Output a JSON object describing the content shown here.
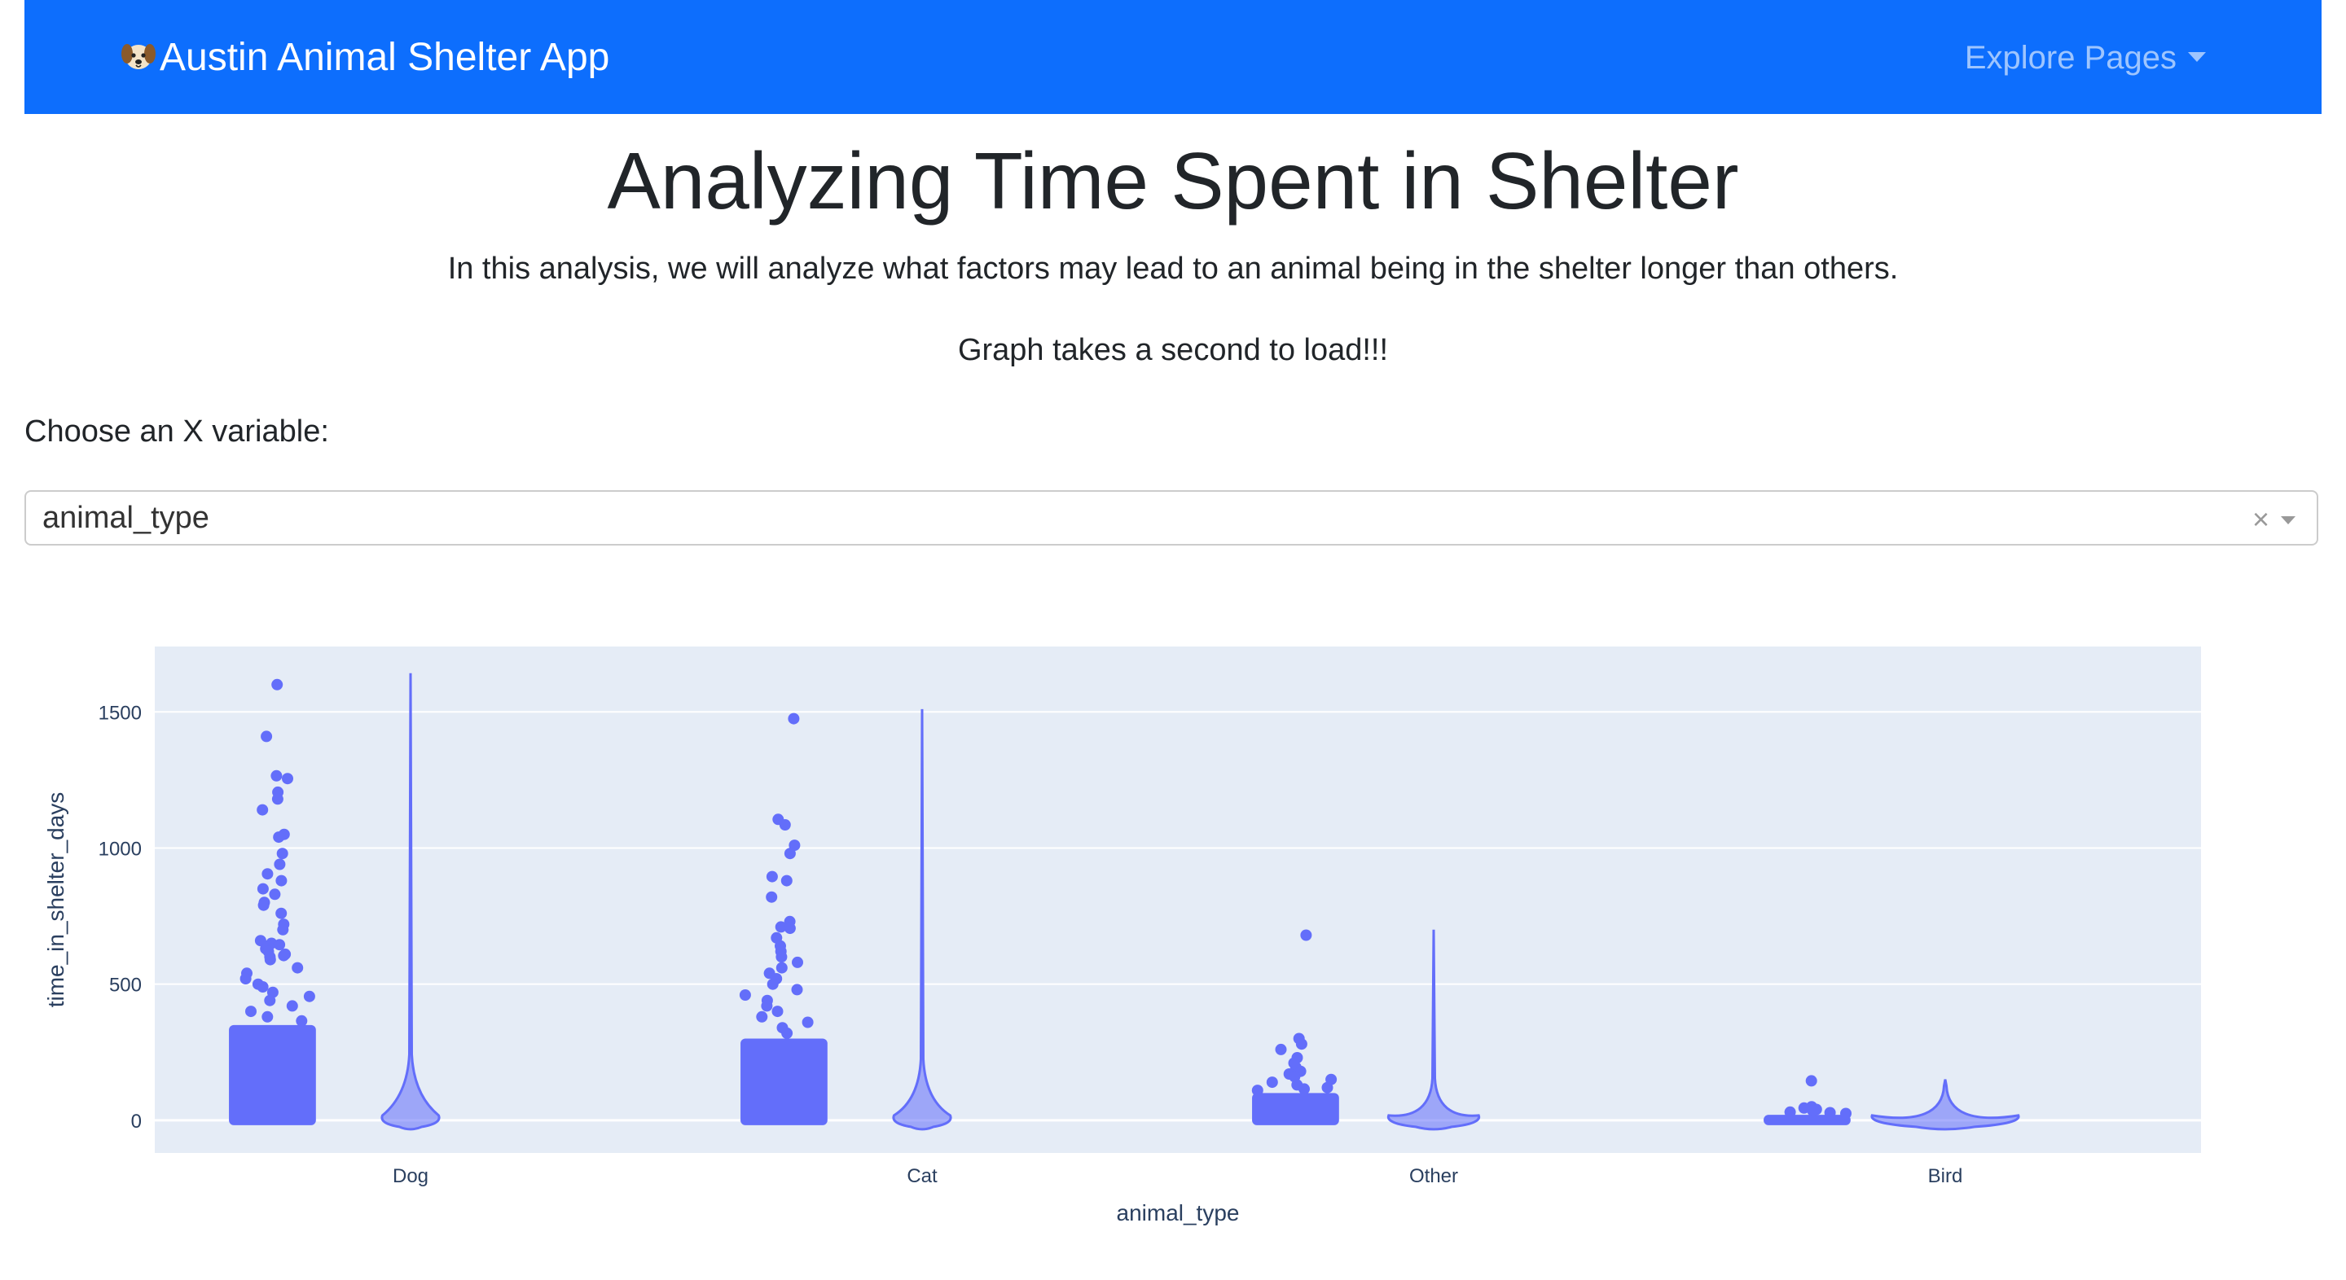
{
  "navbar": {
    "brand": "Austin Animal Shelter App",
    "brand_icon": "dog-face-icon",
    "explore_label": "Explore Pages",
    "bg_color": "#0d6efd"
  },
  "header": {
    "title": "Analyzing Time Spent in Shelter",
    "description": "In this analysis, we will analyze what factors may lead to an animal being in the shelter longer than others.",
    "load_note": "Graph takes a second to load!!!"
  },
  "controls": {
    "x_variable_label": "Choose an X variable:",
    "x_variable_value": "animal_type",
    "clear_glyph": "×"
  },
  "chart_data": {
    "type": "violin",
    "points": "all",
    "color": "#636efa",
    "xlabel": "animal_type",
    "ylabel": "time_in_shelter_days",
    "ylim": [
      -120,
      1740
    ],
    "yticks": [
      0,
      500,
      1000,
      1500
    ],
    "grid": true,
    "categories": [
      "Dog",
      "Cat",
      "Other",
      "Bird"
    ],
    "series": [
      {
        "category": "Dog",
        "max": 1642,
        "dense_max": 350,
        "outliers": [
          1600,
          1410,
          1265,
          1255,
          1205,
          1180,
          1140,
          1050,
          1040,
          980,
          940,
          905,
          880,
          850,
          830,
          800,
          790,
          760,
          720,
          700,
          660,
          650,
          645,
          640,
          630,
          620,
          610,
          605,
          600,
          590,
          560,
          540,
          520,
          500,
          490,
          470,
          455,
          440,
          420,
          400,
          380,
          365
        ]
      },
      {
        "category": "Cat",
        "max": 1510,
        "dense_max": 300,
        "outliers": [
          1475,
          1105,
          1085,
          1010,
          980,
          895,
          880,
          820,
          730,
          710,
          705,
          670,
          640,
          620,
          600,
          580,
          560,
          540,
          520,
          500,
          480,
          460,
          440,
          420,
          400,
          380,
          360,
          340,
          320
        ]
      },
      {
        "category": "Other",
        "max": 700,
        "dense_max": 100,
        "outliers": [
          680,
          300,
          280,
          260,
          230,
          210,
          195,
          180,
          170,
          160,
          150,
          140,
          130,
          120,
          115,
          110
        ]
      },
      {
        "category": "Bird",
        "max": 150,
        "dense_max": 20,
        "outliers": [
          145,
          50,
          45,
          40,
          35,
          30,
          28,
          25
        ]
      }
    ]
  }
}
